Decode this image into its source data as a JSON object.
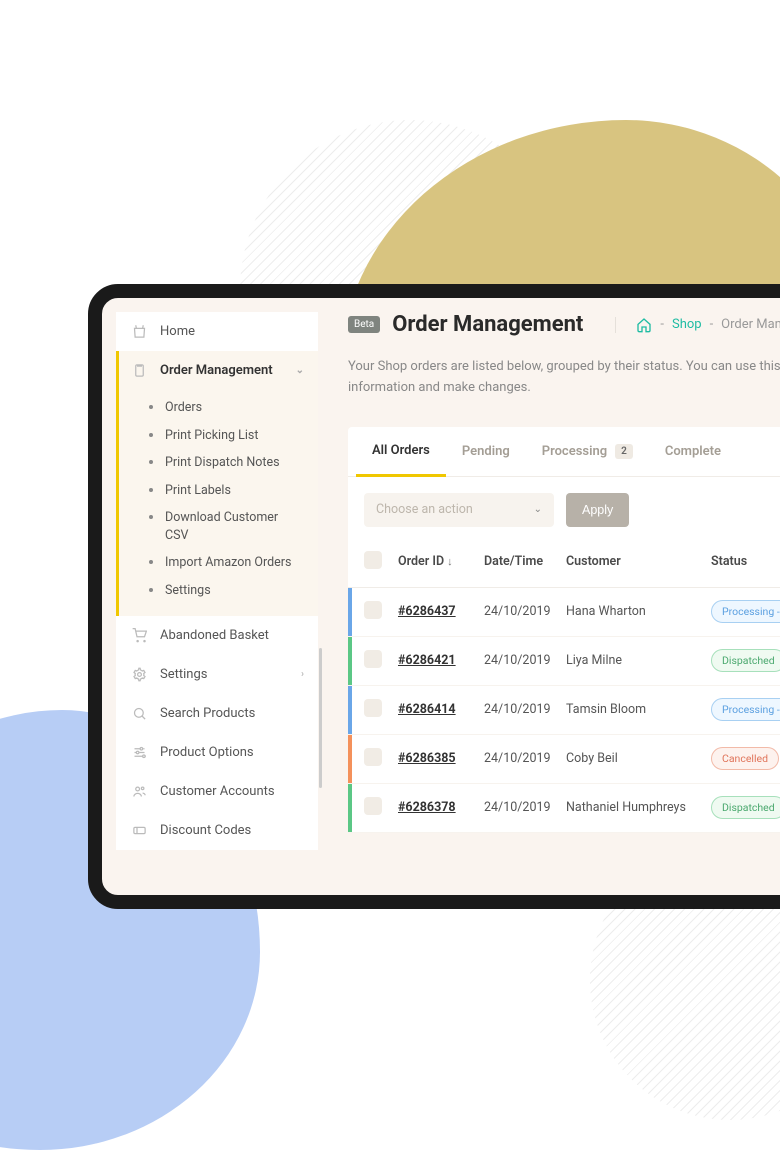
{
  "sidebar": {
    "items": [
      {
        "label": "Home",
        "icon": "home"
      },
      {
        "label": "Order Management",
        "icon": "clipboard",
        "active": true
      },
      {
        "label": "Abandoned Basket",
        "icon": "cart"
      },
      {
        "label": "Settings",
        "icon": "gear"
      },
      {
        "label": "Search Products",
        "icon": "search"
      },
      {
        "label": "Product Options",
        "icon": "sliders"
      },
      {
        "label": "Customer Accounts",
        "icon": "users"
      },
      {
        "label": "Discount Codes",
        "icon": "ticket"
      }
    ],
    "subitems": [
      "Orders",
      "Print Picking List",
      "Print Dispatch Notes",
      "Print Labels",
      "Download Customer CSV",
      "Import Amazon Orders",
      "Settings"
    ]
  },
  "header": {
    "badge": "Beta",
    "title": "Order Management",
    "breadcrumb": {
      "shop": "Shop",
      "current": "Order Management"
    }
  },
  "description": "Your Shop orders are listed below, grouped by their status. You can use this page to view order information and make changes.",
  "tabs": [
    {
      "label": "All Orders",
      "active": true
    },
    {
      "label": "Pending"
    },
    {
      "label": "Processing",
      "badge": "2"
    },
    {
      "label": "Complete"
    }
  ],
  "action_select": {
    "placeholder": "Choose an action"
  },
  "apply_label": "Apply",
  "columns": {
    "order_id": "Order ID",
    "date": "Date/Time",
    "customer": "Customer",
    "status": "Status"
  },
  "rows": [
    {
      "id": "#6286437",
      "date": "24/10/2019",
      "customer": "Hana Wharton",
      "status": "Processing - P",
      "status_kind": "processing",
      "bar": "blue"
    },
    {
      "id": "#6286421",
      "date": "24/10/2019",
      "customer": "Liya Milne",
      "status": "Dispatched",
      "status_kind": "dispatched",
      "bar": "green"
    },
    {
      "id": "#6286414",
      "date": "24/10/2019",
      "customer": "Tamsin Bloom",
      "status": "Processing - W",
      "status_kind": "processing",
      "bar": "blue"
    },
    {
      "id": "#6286385",
      "date": "24/10/2019",
      "customer": "Coby Beil",
      "status": "Cancelled",
      "status_kind": "cancelled",
      "bar": "orange"
    },
    {
      "id": "#6286378",
      "date": "24/10/2019",
      "customer": "Nathaniel Humphreys",
      "status": "Dispatched",
      "status_kind": "dispatched",
      "bar": "green"
    }
  ]
}
